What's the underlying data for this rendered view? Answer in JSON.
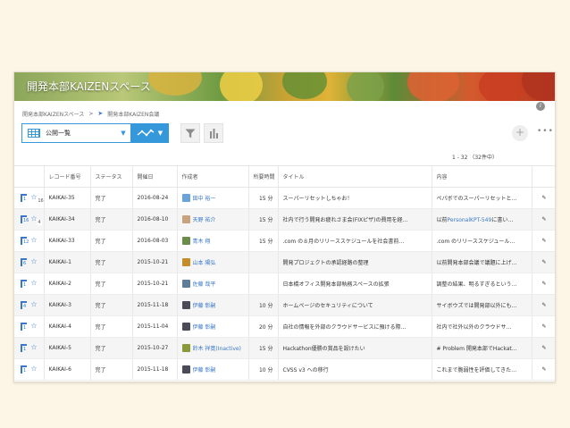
{
  "space": {
    "title": "開発本部KAIZENスペース",
    "breadcrumb": [
      "開発本部KAIZENスペース",
      "開発本部KAIZEN会議"
    ],
    "breadcrumb_sep": ">"
  },
  "toolbar": {
    "view_label": "公開一覧",
    "more": "•••",
    "plus": "+"
  },
  "pager": "1 - 32 （32件中）",
  "columns": [
    "レコード番号",
    "ステータス",
    "開催日",
    "作成者",
    "所要時間",
    "タイトル",
    "内容"
  ],
  "rows": [
    {
      "badge": "1",
      "likes": "16",
      "id": "KAIKAI-35",
      "status": "完了",
      "date": "2016-08-24",
      "user": "田中 裕一",
      "avatar": "#6aa3d8",
      "time": "15 分",
      "title": "スーパーリセットしちゃお！",
      "content": "ペパボでのスーパーリセットと…"
    },
    {
      "badge": "16",
      "likes": "4",
      "id": "KAIKAI-34",
      "status": "完了",
      "date": "2016-08-10",
      "user": "天野 祐介",
      "avatar": "#c9a37d",
      "time": "15 分",
      "title": "社内で行う開発お疲れさま会(FIXピザ)の費用を経…",
      "content_pre": "以前",
      "content_link": "PersonalKPT-549",
      "content_post": "に書い…"
    },
    {
      "badge": "12",
      "likes": "",
      "id": "KAIKAI-33",
      "status": "完了",
      "date": "2016-08-03",
      "user": "青木 翔",
      "avatar": "#6b8c4a",
      "time": "15 分",
      "title": ".com の８月のリリーススケジュールを社会書前…",
      "content": ".com のリリーススケジュール…"
    },
    {
      "badge": "6",
      "likes": "",
      "id": "KAIKAI-1",
      "status": "完了",
      "date": "2015-10-21",
      "user": "山本 陽弘",
      "avatar": "#c58c2a",
      "time": "",
      "title": "開発プロジェクトの承認経路の整理",
      "content": "以前開発本部会議で議題に上げ…"
    },
    {
      "badge": "1",
      "likes": "",
      "id": "KAIKAI-2",
      "status": "完了",
      "date": "2015-10-21",
      "user": "佐藤 哉平",
      "avatar": "#5f7d9b",
      "time": "",
      "title": "日本橋オフィス開発本部執務スペースの拡張",
      "content": "調整の結果、明るすぎるという…"
    },
    {
      "badge": "4",
      "likes": "",
      "id": "KAIKAI-3",
      "status": "完了",
      "date": "2015-11-18",
      "user": "伊藤 彰嗣",
      "avatar": "#4a4a58",
      "time": "10 分",
      "title": "ホームページのセキュリティについて",
      "content": "サイボウズでは開発部以外にも…"
    },
    {
      "badge": "1",
      "likes": "",
      "id": "KAIKAI-4",
      "status": "完了",
      "date": "2015-11-04",
      "user": "伊藤 彰嗣",
      "avatar": "#4a4a58",
      "time": "20 分",
      "title": "自社の情報を外部のクラウドサービスに預ける際…",
      "content": "社内で社外以外のクラウドサ…"
    },
    {
      "badge": "1",
      "likes": "",
      "id": "KAIKAI-5",
      "status": "完了",
      "date": "2015-10-27",
      "user": "鈴木 祥寛(Inactive)",
      "avatar": "#8a9a3a",
      "time": "15 分",
      "title": "Hackathon優勝の賞品を設けたい",
      "content": "# Problem 開発本部でHackat…"
    },
    {
      "badge": "1",
      "likes": "",
      "id": "KAIKAI-6",
      "status": "完了",
      "date": "2015-11-18",
      "user": "伊藤 彰嗣",
      "avatar": "#4a4a58",
      "time": "10 分",
      "title": "CVSS v3 への移行",
      "content": "これまで脆弱性を評価してきた…"
    }
  ]
}
